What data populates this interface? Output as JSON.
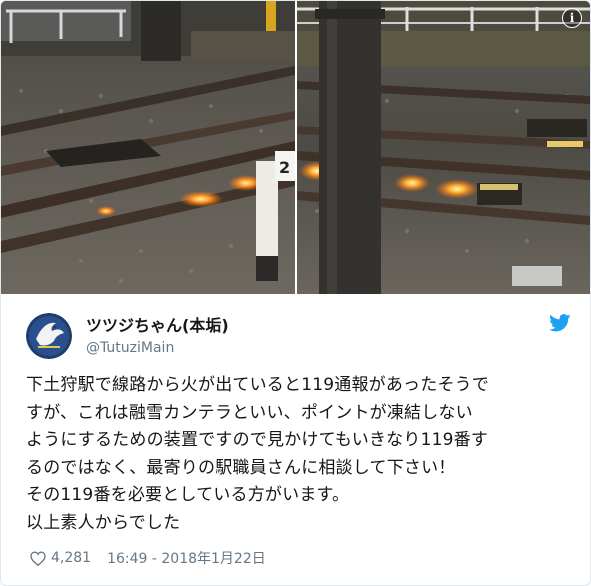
{
  "media": {
    "info_icon": "info-icon",
    "post_sign_text": "2"
  },
  "author": {
    "display_name": "ツツジちゃん(本垢)",
    "handle": "@TutuziMain",
    "avatar_icon": "avatar-eagle-icon"
  },
  "brand_icon": "twitter-bird-icon",
  "tweet": {
    "lines": [
      "下土狩駅で線路から火が出ていると119通報があったそうで",
      "すが、これは融雪カンテラといい、ポイントが凍結しない",
      "ようにするための装置ですので見かけてもいきなり119番す",
      "るのではなく、最寄りの駅職員さんに相談して下さい！",
      "その119番を必要としている方がいます。",
      "以上素人からでした"
    ]
  },
  "footer": {
    "like_icon": "heart-icon",
    "like_count": "4,281",
    "timestamp": "16:49 - 2018年1月22日"
  },
  "colors": {
    "twitter_blue": "#1da1f2",
    "secondary_text": "#657786",
    "primary_text": "#14171a",
    "border": "#e1e8ed"
  }
}
